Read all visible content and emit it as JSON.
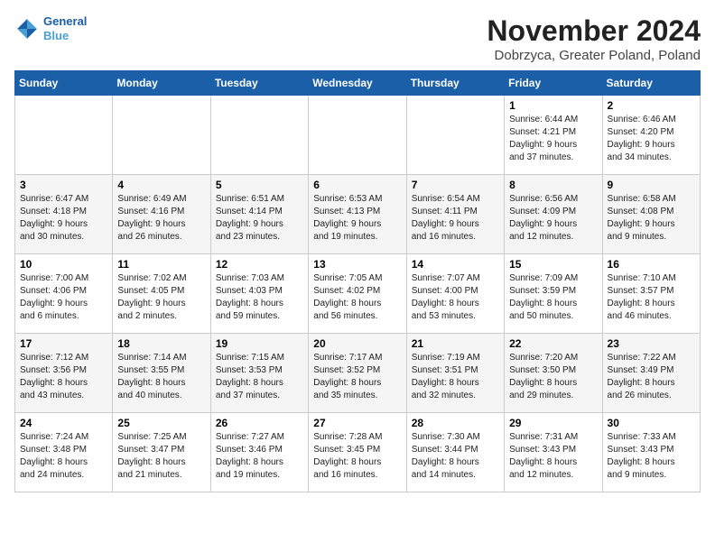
{
  "header": {
    "logo_line1": "General",
    "logo_line2": "Blue",
    "title": "November 2024",
    "subtitle": "Dobrzyca, Greater Poland, Poland"
  },
  "weekdays": [
    "Sunday",
    "Monday",
    "Tuesday",
    "Wednesday",
    "Thursday",
    "Friday",
    "Saturday"
  ],
  "weeks": [
    [
      {
        "day": "",
        "info": ""
      },
      {
        "day": "",
        "info": ""
      },
      {
        "day": "",
        "info": ""
      },
      {
        "day": "",
        "info": ""
      },
      {
        "day": "",
        "info": ""
      },
      {
        "day": "1",
        "info": "Sunrise: 6:44 AM\nSunset: 4:21 PM\nDaylight: 9 hours\nand 37 minutes."
      },
      {
        "day": "2",
        "info": "Sunrise: 6:46 AM\nSunset: 4:20 PM\nDaylight: 9 hours\nand 34 minutes."
      }
    ],
    [
      {
        "day": "3",
        "info": "Sunrise: 6:47 AM\nSunset: 4:18 PM\nDaylight: 9 hours\nand 30 minutes."
      },
      {
        "day": "4",
        "info": "Sunrise: 6:49 AM\nSunset: 4:16 PM\nDaylight: 9 hours\nand 26 minutes."
      },
      {
        "day": "5",
        "info": "Sunrise: 6:51 AM\nSunset: 4:14 PM\nDaylight: 9 hours\nand 23 minutes."
      },
      {
        "day": "6",
        "info": "Sunrise: 6:53 AM\nSunset: 4:13 PM\nDaylight: 9 hours\nand 19 minutes."
      },
      {
        "day": "7",
        "info": "Sunrise: 6:54 AM\nSunset: 4:11 PM\nDaylight: 9 hours\nand 16 minutes."
      },
      {
        "day": "8",
        "info": "Sunrise: 6:56 AM\nSunset: 4:09 PM\nDaylight: 9 hours\nand 12 minutes."
      },
      {
        "day": "9",
        "info": "Sunrise: 6:58 AM\nSunset: 4:08 PM\nDaylight: 9 hours\nand 9 minutes."
      }
    ],
    [
      {
        "day": "10",
        "info": "Sunrise: 7:00 AM\nSunset: 4:06 PM\nDaylight: 9 hours\nand 6 minutes."
      },
      {
        "day": "11",
        "info": "Sunrise: 7:02 AM\nSunset: 4:05 PM\nDaylight: 9 hours\nand 2 minutes."
      },
      {
        "day": "12",
        "info": "Sunrise: 7:03 AM\nSunset: 4:03 PM\nDaylight: 8 hours\nand 59 minutes."
      },
      {
        "day": "13",
        "info": "Sunrise: 7:05 AM\nSunset: 4:02 PM\nDaylight: 8 hours\nand 56 minutes."
      },
      {
        "day": "14",
        "info": "Sunrise: 7:07 AM\nSunset: 4:00 PM\nDaylight: 8 hours\nand 53 minutes."
      },
      {
        "day": "15",
        "info": "Sunrise: 7:09 AM\nSunset: 3:59 PM\nDaylight: 8 hours\nand 50 minutes."
      },
      {
        "day": "16",
        "info": "Sunrise: 7:10 AM\nSunset: 3:57 PM\nDaylight: 8 hours\nand 46 minutes."
      }
    ],
    [
      {
        "day": "17",
        "info": "Sunrise: 7:12 AM\nSunset: 3:56 PM\nDaylight: 8 hours\nand 43 minutes."
      },
      {
        "day": "18",
        "info": "Sunrise: 7:14 AM\nSunset: 3:55 PM\nDaylight: 8 hours\nand 40 minutes."
      },
      {
        "day": "19",
        "info": "Sunrise: 7:15 AM\nSunset: 3:53 PM\nDaylight: 8 hours\nand 37 minutes."
      },
      {
        "day": "20",
        "info": "Sunrise: 7:17 AM\nSunset: 3:52 PM\nDaylight: 8 hours\nand 35 minutes."
      },
      {
        "day": "21",
        "info": "Sunrise: 7:19 AM\nSunset: 3:51 PM\nDaylight: 8 hours\nand 32 minutes."
      },
      {
        "day": "22",
        "info": "Sunrise: 7:20 AM\nSunset: 3:50 PM\nDaylight: 8 hours\nand 29 minutes."
      },
      {
        "day": "23",
        "info": "Sunrise: 7:22 AM\nSunset: 3:49 PM\nDaylight: 8 hours\nand 26 minutes."
      }
    ],
    [
      {
        "day": "24",
        "info": "Sunrise: 7:24 AM\nSunset: 3:48 PM\nDaylight: 8 hours\nand 24 minutes."
      },
      {
        "day": "25",
        "info": "Sunrise: 7:25 AM\nSunset: 3:47 PM\nDaylight: 8 hours\nand 21 minutes."
      },
      {
        "day": "26",
        "info": "Sunrise: 7:27 AM\nSunset: 3:46 PM\nDaylight: 8 hours\nand 19 minutes."
      },
      {
        "day": "27",
        "info": "Sunrise: 7:28 AM\nSunset: 3:45 PM\nDaylight: 8 hours\nand 16 minutes."
      },
      {
        "day": "28",
        "info": "Sunrise: 7:30 AM\nSunset: 3:44 PM\nDaylight: 8 hours\nand 14 minutes."
      },
      {
        "day": "29",
        "info": "Sunrise: 7:31 AM\nSunset: 3:43 PM\nDaylight: 8 hours\nand 12 minutes."
      },
      {
        "day": "30",
        "info": "Sunrise: 7:33 AM\nSunset: 3:43 PM\nDaylight: 8 hours\nand 9 minutes."
      }
    ]
  ]
}
